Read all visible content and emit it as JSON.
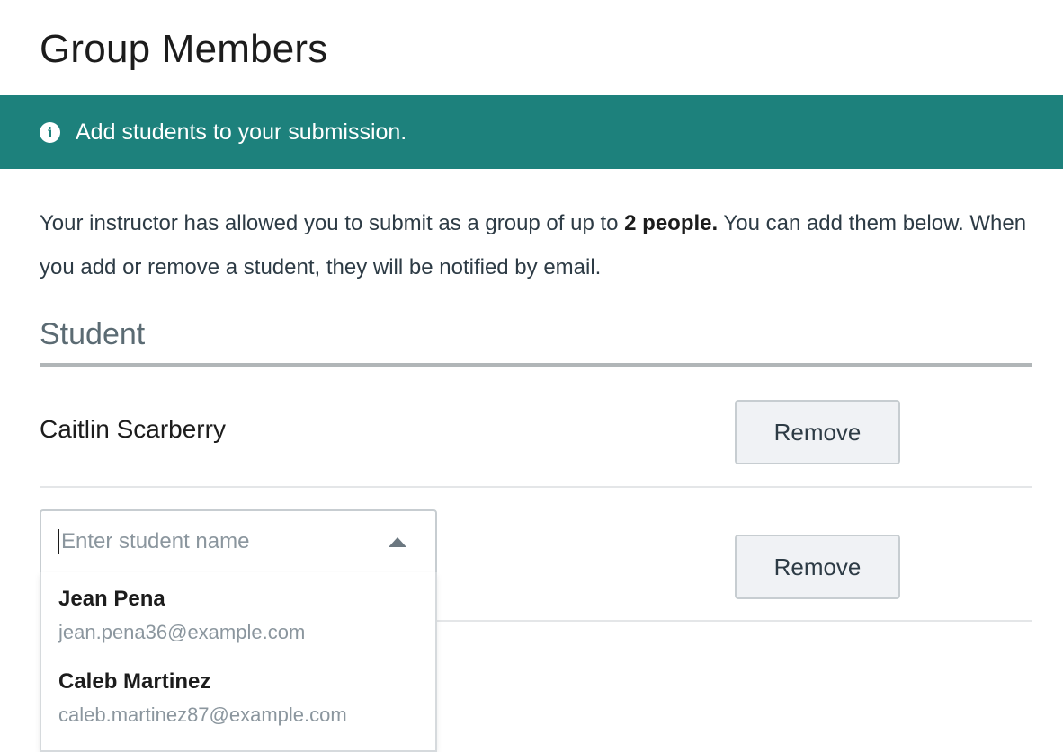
{
  "page": {
    "title": "Group Members"
  },
  "banner": {
    "icon": "info-icon",
    "message": "Add students to your submission.",
    "color": "#1d817c"
  },
  "description": {
    "before": "Your instructor has allowed you to submit as a group of up to ",
    "bold": "2 people.",
    "after": " You can add them below. When you add or remove a student, they will be notified by email."
  },
  "section": {
    "header": "Student"
  },
  "members": [
    {
      "name": "Caitlin Scarberry",
      "remove_label": "Remove"
    }
  ],
  "new_member": {
    "placeholder": "Enter student name",
    "value": "",
    "remove_label": "Remove",
    "dropdown_open": true
  },
  "suggestions": [
    {
      "name": "Jean Pena",
      "email": "jean.pena36@example.com"
    },
    {
      "name": "Caleb Martinez",
      "email": "caleb.martinez87@example.com"
    }
  ]
}
